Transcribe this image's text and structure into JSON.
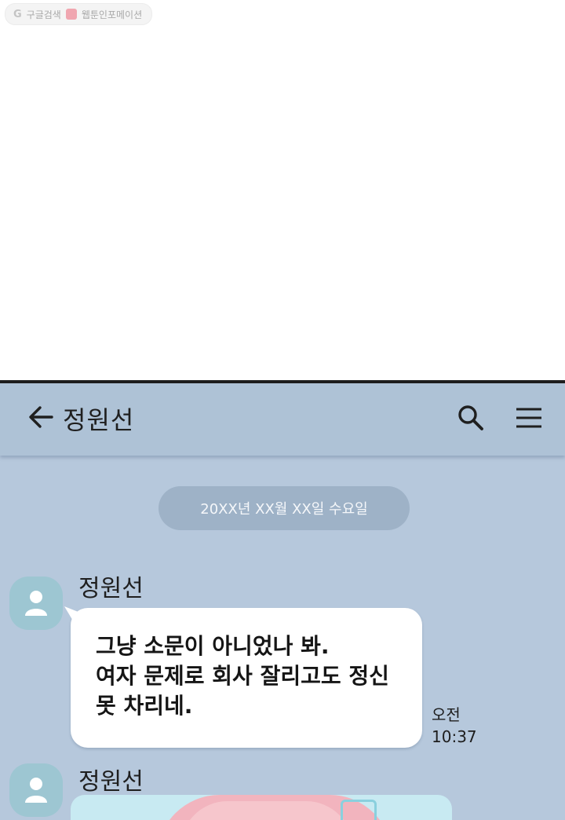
{
  "watermark": {
    "search_text": "구글검색",
    "site_text": "웹툰인포메이션"
  },
  "chat": {
    "contact_name": "정원선",
    "date_label": "20XX년 XX월 XX일 수요일",
    "messages": [
      {
        "sender": "정원선",
        "lines": [
          "그냥 소문이 아니었나 봐.",
          "여자 문제로 회사 잘리고도 정신",
          "못 차리네."
        ],
        "time_period": "오전",
        "time": "10:37"
      },
      {
        "sender": "정원선",
        "type": "image"
      }
    ]
  },
  "colors": {
    "chat_background": "#b6c8dc",
    "header_background": "#aec2d6",
    "date_pill": "#9eb2c7",
    "avatar": "#9dc6d2",
    "bubble": "#ffffff"
  }
}
